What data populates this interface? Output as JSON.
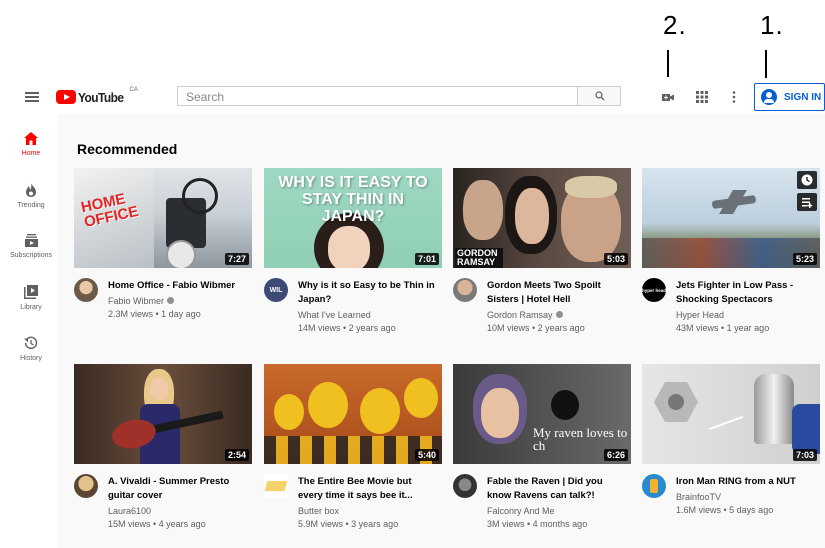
{
  "annotations": {
    "label_1": "1.",
    "label_2": "2."
  },
  "header": {
    "logo_text": "YouTube",
    "logo_country": "CA",
    "search_placeholder": "Search",
    "signin_label": "SIGN IN"
  },
  "sidebar": {
    "items": [
      {
        "label": "Home",
        "icon": "home-icon",
        "active": true
      },
      {
        "label": "Trending",
        "icon": "flame-icon"
      },
      {
        "label": "Subscriptions",
        "icon": "subscriptions-icon"
      },
      {
        "label": "Library",
        "icon": "library-icon"
      },
      {
        "label": "History",
        "icon": "history-icon"
      }
    ]
  },
  "main": {
    "section_title": "Recommended",
    "videos": [
      {
        "title": "Home Office - Fabio Wibmer",
        "channel": "Fabio Wibmer",
        "verified": true,
        "views": "2.3M views • 1 day ago",
        "duration": "7:27",
        "thumb_text": "HOME OFFICE"
      },
      {
        "title": "Why is it so Easy to be Thin in Japan?",
        "channel": "What I've Learned",
        "verified": false,
        "views": "14M views • 2 years ago",
        "duration": "7:01",
        "thumb_text": "WHY IS IT EASY TO STAY THIN IN JAPAN?",
        "avatar_text": "WIL"
      },
      {
        "title": "Gordon Meets Two Spoilt Sisters | Hotel Hell",
        "channel": "Gordon Ramsay",
        "verified": true,
        "views": "10M views • 2 years ago",
        "duration": "5:03",
        "thumb_text": "GORDON RAMSAY"
      },
      {
        "title": "Jets Fighter in Low Pass - Shocking Spectacors",
        "channel": "Hyper Head",
        "verified": false,
        "views": "43M views • 1 year ago",
        "duration": "5:23",
        "avatar_text": "hyper head"
      },
      {
        "title": "A. Vivaldi - Summer Presto guitar cover",
        "channel": "Laura6100",
        "verified": false,
        "views": "15M views • 4 years ago",
        "duration": "2:54"
      },
      {
        "title": "The Entire Bee Movie but every time it says bee it...",
        "channel": "Butter box",
        "verified": false,
        "views": "5.9M views • 3 years ago",
        "duration": "5:40"
      },
      {
        "title": "Fable the Raven | Did you know Ravens can talk?!",
        "channel": "Falconry And Me",
        "verified": false,
        "views": "3M views • 4 months ago",
        "duration": "6:26",
        "thumb_text": "My raven loves to ch"
      },
      {
        "title": "Iron Man RING from a NUT",
        "channel": "BrainfooTV",
        "verified": false,
        "views": "1.6M views • 5 days ago",
        "duration": "7:03"
      }
    ]
  },
  "colors": {
    "brand_red": "#ff0000",
    "link_blue": "#065fd4",
    "background": "#f9f9f9"
  }
}
